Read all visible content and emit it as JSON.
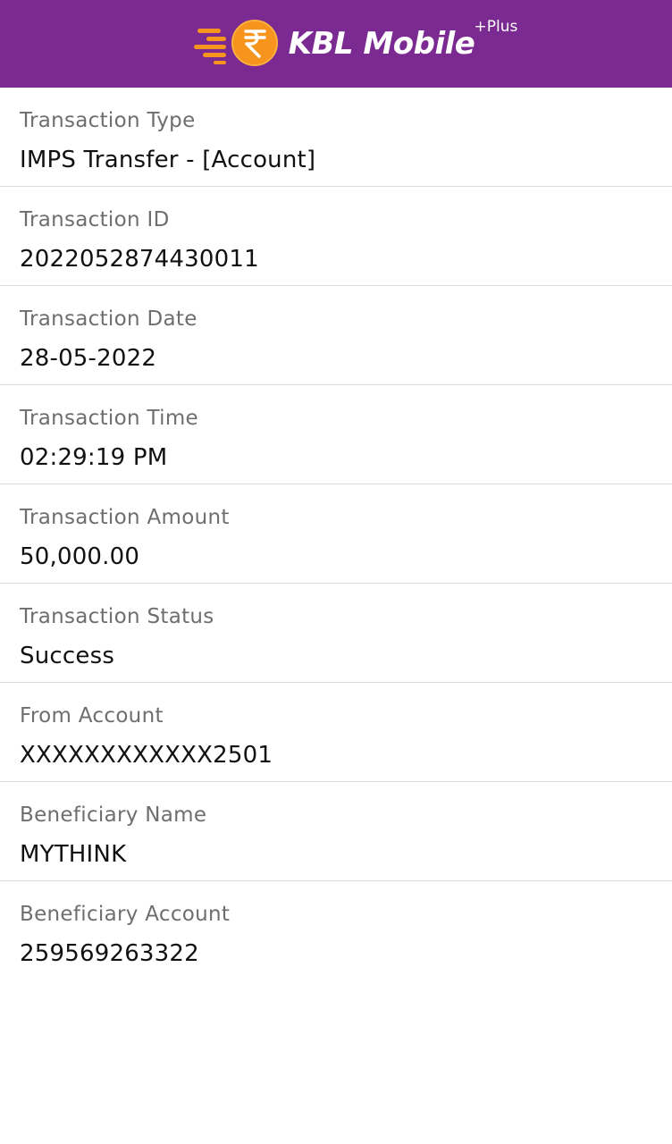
{
  "header": {
    "brand": "KBL Mobile",
    "brand_suffix": "Plus",
    "logo_icon": "rupee-coin-logo-icon",
    "background": "#7b2a91",
    "accent": "#f7941d"
  },
  "details": [
    {
      "label": "Transaction Type",
      "value": "IMPS Transfer - [Account]"
    },
    {
      "label": "Transaction ID",
      "value": "2022052874430011"
    },
    {
      "label": "Transaction Date",
      "value": "28-05-2022"
    },
    {
      "label": "Transaction Time",
      "value": "02:29:19 PM"
    },
    {
      "label": "Transaction Amount",
      "value": "50,000.00"
    },
    {
      "label": "Transaction Status",
      "value": "Success"
    },
    {
      "label": "From Account",
      "value": "XXXXXXXXXXXX2501"
    },
    {
      "label": "Beneficiary Name",
      "value": "MYTHINK"
    },
    {
      "label": "Beneficiary Account",
      "value": "259569263322"
    }
  ]
}
